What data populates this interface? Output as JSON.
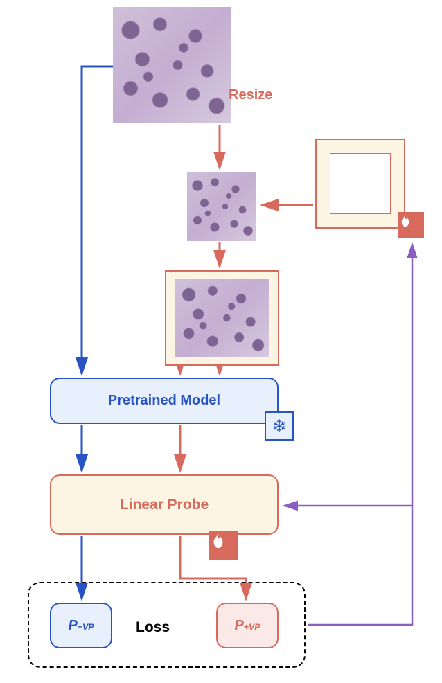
{
  "labels": {
    "resize": "Resize",
    "pretrained_model": "Pretrained Model",
    "linear_probe": "Linear Probe",
    "loss": "Loss",
    "p_minus_base": "P",
    "p_minus_sub": "−VP",
    "p_plus_base": "P",
    "p_plus_sub": "+VP"
  },
  "icons": {
    "frozen": "❄",
    "trainable": "🔥"
  },
  "colors": {
    "blue": "#2753c5",
    "red": "#d8695d",
    "purple": "#8b5fbf",
    "cream": "#fcf5e4",
    "blue_fill": "#e8f0fd",
    "red_fill": "#fbe9e8"
  },
  "diagram": {
    "nodes": [
      "input-image",
      "resized-image",
      "visual-prompt-frame",
      "prompted-image",
      "pretrained-model",
      "linear-probe",
      "p-minus-vp",
      "p-plus-vp",
      "loss"
    ],
    "edges": [
      {
        "from": "input-image",
        "to": "resized-image",
        "label": "Resize",
        "color": "red"
      },
      {
        "from": "visual-prompt-frame",
        "to": "resized-image",
        "color": "red"
      },
      {
        "from": "resized-image",
        "to": "prompted-image",
        "color": "red"
      },
      {
        "from": "input-image",
        "to": "pretrained-model",
        "color": "blue"
      },
      {
        "from": "prompted-image",
        "to": "pretrained-model",
        "color": "red"
      },
      {
        "from": "pretrained-model",
        "to": "linear-probe",
        "color": "blue"
      },
      {
        "from": "pretrained-model",
        "to": "linear-probe",
        "color": "red"
      },
      {
        "from": "linear-probe",
        "to": "p-minus-vp",
        "color": "blue"
      },
      {
        "from": "linear-probe",
        "to": "p-plus-vp",
        "color": "red"
      },
      {
        "from": "loss",
        "to": "visual-prompt-frame",
        "color": "purple",
        "backprop": true
      },
      {
        "from": "loss",
        "to": "linear-probe",
        "color": "purple",
        "backprop": true
      }
    ],
    "badges": [
      {
        "on": "pretrained-model",
        "type": "frozen"
      },
      {
        "on": "linear-probe",
        "type": "trainable"
      },
      {
        "on": "visual-prompt-frame",
        "type": "trainable"
      }
    ]
  }
}
